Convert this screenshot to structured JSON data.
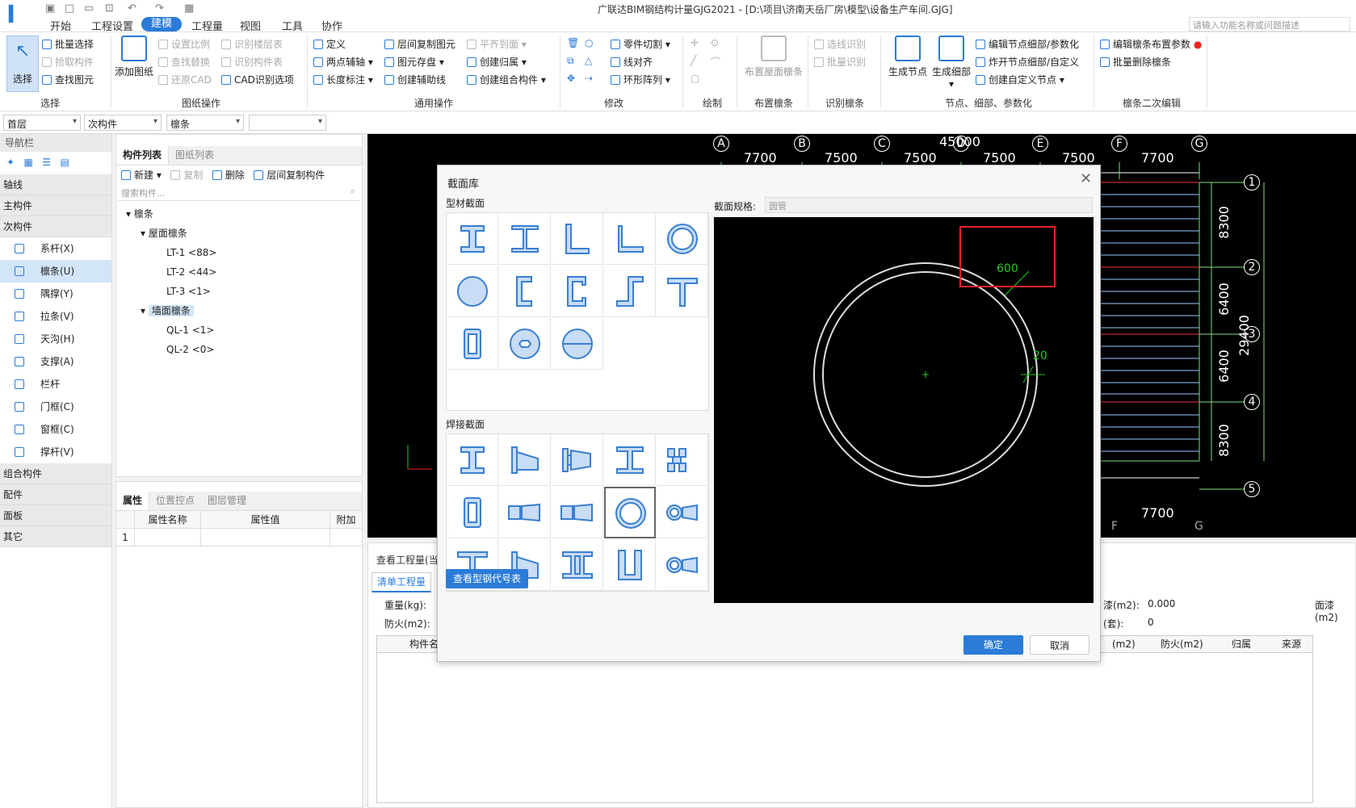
{
  "app": {
    "title": "广联达BIM钢结构计量GJG2021 - [D:\\项目\\济南天岳厂房\\模型\\设备生产车间.GJG]",
    "search_placeholder": "请输入功能名称或问题描述",
    "menu": [
      "开始",
      "工程设置",
      "建模",
      "工程量",
      "视图",
      "工具",
      "协作"
    ]
  },
  "ribbon": {
    "select": {
      "big": "选择",
      "items": [
        "批量选择",
        "拾取构件",
        "查找图元"
      ],
      "label": "选择"
    },
    "drawing": {
      "big": "添加图纸",
      "items": [
        "设置比例",
        "查找替换",
        "还原CAD",
        "识别楼层表",
        "识别构件表",
        "CAD识别选项"
      ],
      "label": "图纸操作"
    },
    "common": {
      "items": [
        "定义",
        "两点辅轴",
        "长度标注",
        "层间复制图元",
        "图元存盘",
        "创建辅助线",
        "平齐到面",
        "创建归属",
        "创建组合构件"
      ],
      "label": "通用操作"
    },
    "modify": {
      "items": [
        "零件切割",
        "线对齐",
        "环形阵列"
      ],
      "label": "修改"
    },
    "draw": {
      "label": "绘制"
    },
    "purlin_layout": {
      "big": "布置屋面檩条",
      "label": "布置檩条"
    },
    "recognize": {
      "items": [
        "选线识别",
        "批量识别"
      ],
      "label": "识别檩条"
    },
    "nodes": {
      "big1": "生成节点",
      "big2": "生成细部",
      "items": [
        "编辑节点细部/参数化",
        "炸开节点细部/自定义",
        "创建自定义节点"
      ],
      "label": "节点、细部、参数化"
    },
    "purlin_edit": {
      "items": [
        "编辑檩条布置参数",
        "批量删除檩条"
      ],
      "label": "檩条二次编辑"
    }
  },
  "filters": [
    "首层",
    "次构件",
    "檩条",
    ""
  ],
  "nav": {
    "title": "导航栏",
    "cats": [
      "轴线",
      "主构件",
      "次构件"
    ],
    "items": [
      "系杆(X)",
      "檩条(U)",
      "隅撑(Y)",
      "拉条(V)",
      "天沟(H)",
      "支撑(A)",
      "栏杆",
      "门框(C)",
      "窗框(C)",
      "撑杆(V)"
    ],
    "cats2": [
      "组合构件",
      "配件",
      "面板",
      "其它"
    ]
  },
  "components": {
    "tabs": [
      "构件列表",
      "图纸列表"
    ],
    "toolbar": [
      "新建",
      "复制",
      "删除",
      "层间复制构件"
    ],
    "search_placeholder": "搜索构件...",
    "tree": {
      "root": "檩条",
      "roof": "屋面檩条",
      "roof_items": [
        "LT-1 <88>",
        "LT-2 <44>",
        "LT-3 <1>"
      ],
      "wall": "墙面檩条",
      "wall_items": [
        "QL-1 <1>",
        "QL-2 <0>"
      ]
    }
  },
  "props": {
    "tabs": [
      "属性",
      "位置控点",
      "图层管理"
    ],
    "cols": [
      "属性名称",
      "属性值",
      "附加"
    ],
    "row1": "1"
  },
  "canvas": {
    "axes_top": [
      "A",
      "B",
      "C",
      "D",
      "E",
      "F",
      "G"
    ],
    "axes_right": [
      "1",
      "2",
      "3",
      "4",
      "5"
    ],
    "total": "45000",
    "spans": [
      "7700",
      "7500",
      "7500",
      "7500",
      "7500",
      "7700"
    ],
    "right_dims": [
      "8300",
      "6400",
      "6400",
      "8300"
    ],
    "right_total": "29400",
    "bottom_axes": [
      "F",
      "G"
    ],
    "bottom_span": "7700"
  },
  "bottom": {
    "title": "查看工程量(当",
    "tab": "清单工程量",
    "weight": "重量(kg):",
    "fire": "防火(m2):",
    "paint_label": "漆(m2):",
    "paint_val": "0.000",
    "set_label": "(套):",
    "set_val": "0",
    "mianqi": "面漆(m2)",
    "cols": [
      "构件名",
      "(m2)",
      "防火(m2)",
      "归属",
      "来源"
    ]
  },
  "dialog": {
    "title": "截面库",
    "profile_section": "型材截面",
    "welded_section": "焊接截面",
    "spec_label": "截面规格:",
    "spec_value": "圆管",
    "dim_outer": "600",
    "dim_thick": "20",
    "view_codes": "查看型钢代号表",
    "ok": "确定",
    "cancel": "取消"
  }
}
